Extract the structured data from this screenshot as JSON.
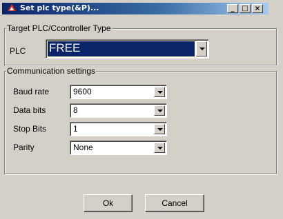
{
  "window": {
    "title": "Set plc type(&P)...",
    "minimize_glyph": "_",
    "maximize_glyph": "□",
    "close_glyph": "×"
  },
  "target_group": {
    "title": "Target PLC/Ccontroller  Type",
    "plc_label": "PLC",
    "plc_value": "FREE"
  },
  "comm_group": {
    "title": "Communication settings",
    "fields": [
      {
        "label": "Baud rate",
        "value": "9600"
      },
      {
        "label": "Data bits",
        "value": "8"
      },
      {
        "label": "Stop Bits",
        "value": "1"
      },
      {
        "label": "Parity",
        "value": "None"
      }
    ]
  },
  "buttons": {
    "ok": "Ok",
    "cancel": "Cancel"
  },
  "colors": {
    "titlebar": "#0a246a",
    "face": "#d4d0c8",
    "selection": "#0a246a"
  },
  "icons": {
    "app": "app-logo-icon",
    "dropdown": "chevron-down-icon"
  }
}
